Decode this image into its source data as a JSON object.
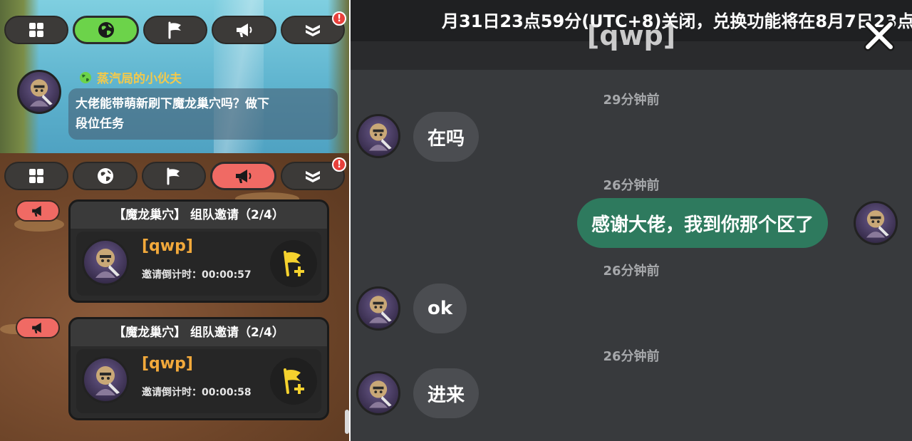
{
  "top_panel": {
    "tabs": [
      {
        "icon": "grid-icon",
        "active": false
      },
      {
        "icon": "globe-icon",
        "active": true
      },
      {
        "icon": "flag-icon",
        "active": false
      },
      {
        "icon": "megaphone-icon",
        "active": false
      },
      {
        "icon": "rank-chevron-icon",
        "active": false,
        "badge": "!"
      }
    ],
    "message": {
      "sender": "蒸汽局的小伙夫",
      "text_line1": "大佬能带萌新刷下魔龙巢穴吗？做下",
      "text_line2": "段位任务"
    }
  },
  "bottom_panel": {
    "tabs": [
      {
        "icon": "grid-icon",
        "active": false
      },
      {
        "icon": "globe-icon",
        "active": false
      },
      {
        "icon": "flag-icon",
        "active": false
      },
      {
        "icon": "megaphone-icon",
        "active": true
      },
      {
        "icon": "rank-chevron-icon",
        "active": false,
        "badge": "!"
      }
    ],
    "invites": [
      {
        "title": "【魔龙巢穴】 组队邀请（2/4）",
        "name": "[qwp]",
        "timer": "邀请倒计时：00:00:57"
      },
      {
        "title": "【魔龙巢穴】 组队邀请（2/4）",
        "name": "[qwp]",
        "timer": "邀请倒计时：00:00:58"
      }
    ]
  },
  "chat": {
    "marquee": "月31日23点59分(UTC+8)关闭，兑换功能将在8月7日23点",
    "title": "[qwp]",
    "messages": [
      {
        "time": "29分钟前",
        "text": "在吗",
        "direction": "in"
      },
      {
        "time": "26分钟前",
        "text": "感谢大佬，我到你那个区了",
        "direction": "out"
      },
      {
        "time": "26分钟前",
        "text": "ok",
        "direction": "in"
      },
      {
        "time": "26分钟前",
        "text": "进来",
        "direction": "in"
      }
    ]
  },
  "colors": {
    "tab_active_green": "#6cd34a",
    "tab_active_red": "#f06a64",
    "sender_gold": "#f2c94c",
    "invite_name_orange": "#f2a93b",
    "bubble_out_green": "#2e7a5e"
  }
}
